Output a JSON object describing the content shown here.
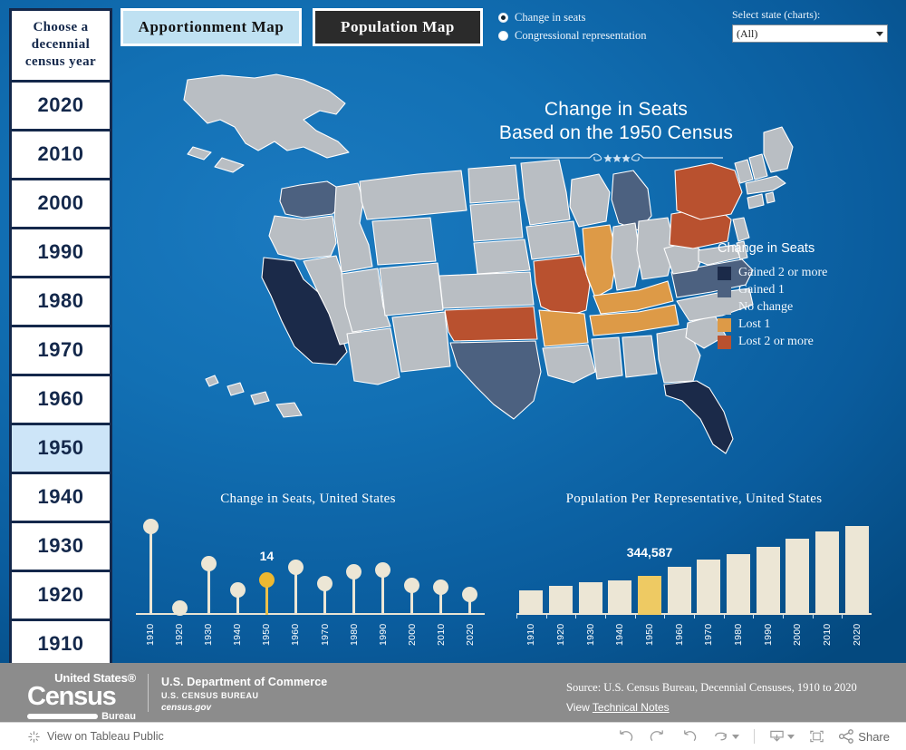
{
  "year_selector": {
    "heading": "Choose a decennial census year",
    "years": [
      "2020",
      "2010",
      "2000",
      "1990",
      "1980",
      "1970",
      "1960",
      "1950",
      "1940",
      "1930",
      "1920",
      "1910"
    ],
    "selected": "1950"
  },
  "tabs": [
    {
      "label": "Apportionment Map",
      "active": true
    },
    {
      "label": "Population Map",
      "active": false
    }
  ],
  "radios": {
    "options": [
      {
        "label": "Change in seats",
        "selected": true
      },
      {
        "label": "Congressional representation",
        "selected": false
      }
    ]
  },
  "state_select": {
    "label": "Select state (charts):",
    "value": "(All)"
  },
  "map": {
    "title_line1": "Change in Seats",
    "title_line2": "Based on the 1950 Census"
  },
  "legend": {
    "title": "Change in Seats",
    "items": [
      {
        "label": "Gained 2 or more",
        "color": "#1b2a49"
      },
      {
        "label": "Gained 1",
        "color": "#4c6180"
      },
      {
        "label": "No change",
        "color": "#b9bec3"
      },
      {
        "label": "Lost 1",
        "color": "#dd9a47"
      },
      {
        "label": "Lost 2 or more",
        "color": "#b9512f"
      }
    ]
  },
  "state_colors": {
    "gain2": "#1b2a49",
    "gain1": "#4c6180",
    "nochange": "#b9bec3",
    "lost1": "#dd9a47",
    "lost2": "#b9512f"
  },
  "chart_data": [
    {
      "type": "lollipop",
      "title": "Change in Seats, United States",
      "categories": [
        "1910",
        "1920",
        "1930",
        "1940",
        "1950",
        "1960",
        "1970",
        "1980",
        "1990",
        "2000",
        "2010",
        "2020"
      ],
      "values": [
        78,
        0,
        45,
        22,
        31,
        42,
        28,
        38,
        40,
        26,
        25,
        18
      ],
      "highlight_index": 4,
      "highlight_label": "14",
      "xlabel": "",
      "ylabel": "",
      "grid": false
    },
    {
      "type": "bar",
      "title": "Population Per Representative, United States",
      "categories": [
        "1910",
        "1920",
        "1930",
        "1940",
        "1950",
        "1960",
        "1970",
        "1980",
        "1990",
        "2000",
        "2010",
        "2020"
      ],
      "values": [
        26,
        30,
        34,
        36,
        41,
        50,
        58,
        64,
        71,
        80,
        87,
        93
      ],
      "highlight_index": 4,
      "highlight_label": "344,587",
      "xlabel": "",
      "ylabel": "",
      "grid": false
    }
  ],
  "footer": {
    "logo_line1": "United States®",
    "logo_line2": "Census",
    "logo_line3": "Bureau",
    "dept1": "U.S. Department of Commerce",
    "dept2": "U.S. CENSUS BUREAU",
    "dept3": "census.gov",
    "source": "Source: U.S. Census Bureau, Decennial Censuses, 1910 to 2020",
    "view_prefix": "View ",
    "view_link": "Technical Notes"
  },
  "tableau_bar": {
    "view_label": "View on Tableau Public",
    "share_label": "Share"
  }
}
